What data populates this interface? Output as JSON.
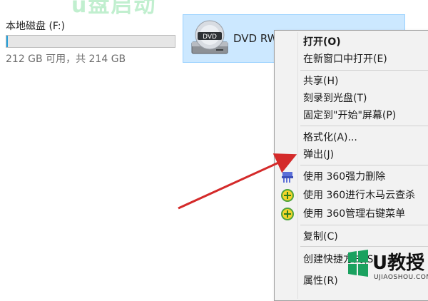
{
  "banner_text": "u盘启动",
  "drive_f": {
    "name": "本地磁盘 (F:)",
    "used_fraction": 0.01,
    "free_text": "212 GB 可用，共 214 GB"
  },
  "dvd": {
    "label": "DVD RW",
    "icon_text": "DVD"
  },
  "context_menu": {
    "items": [
      {
        "label": "打开(O)",
        "bold": true
      },
      {
        "label": "在新窗口中打开(E)"
      },
      {
        "label": "共享(H)"
      },
      {
        "label": "刻录到光盘(T)"
      },
      {
        "label": "固定到\"开始\"屏幕(P)"
      },
      {
        "label": "格式化(A)..."
      },
      {
        "label": "弹出(J)"
      },
      {
        "label": "使用 360强力删除",
        "icon": "360-shredder-icon"
      },
      {
        "label": "使用 360进行木马云查杀",
        "icon": "360-scan-icon"
      },
      {
        "label": "使用 360管理右键菜单",
        "icon": "360-manage-icon"
      },
      {
        "label": "复制(C)"
      },
      {
        "label": "创建快捷方式(S)"
      },
      {
        "label": "属性(R)"
      }
    ]
  },
  "colors": {
    "selection_bg": "#cce8ff",
    "arrow": "#d42a2a",
    "banner": "#8fe2a8"
  },
  "watermark": {
    "brand": "U教授",
    "url": "UJIAOSHOU.COM"
  }
}
